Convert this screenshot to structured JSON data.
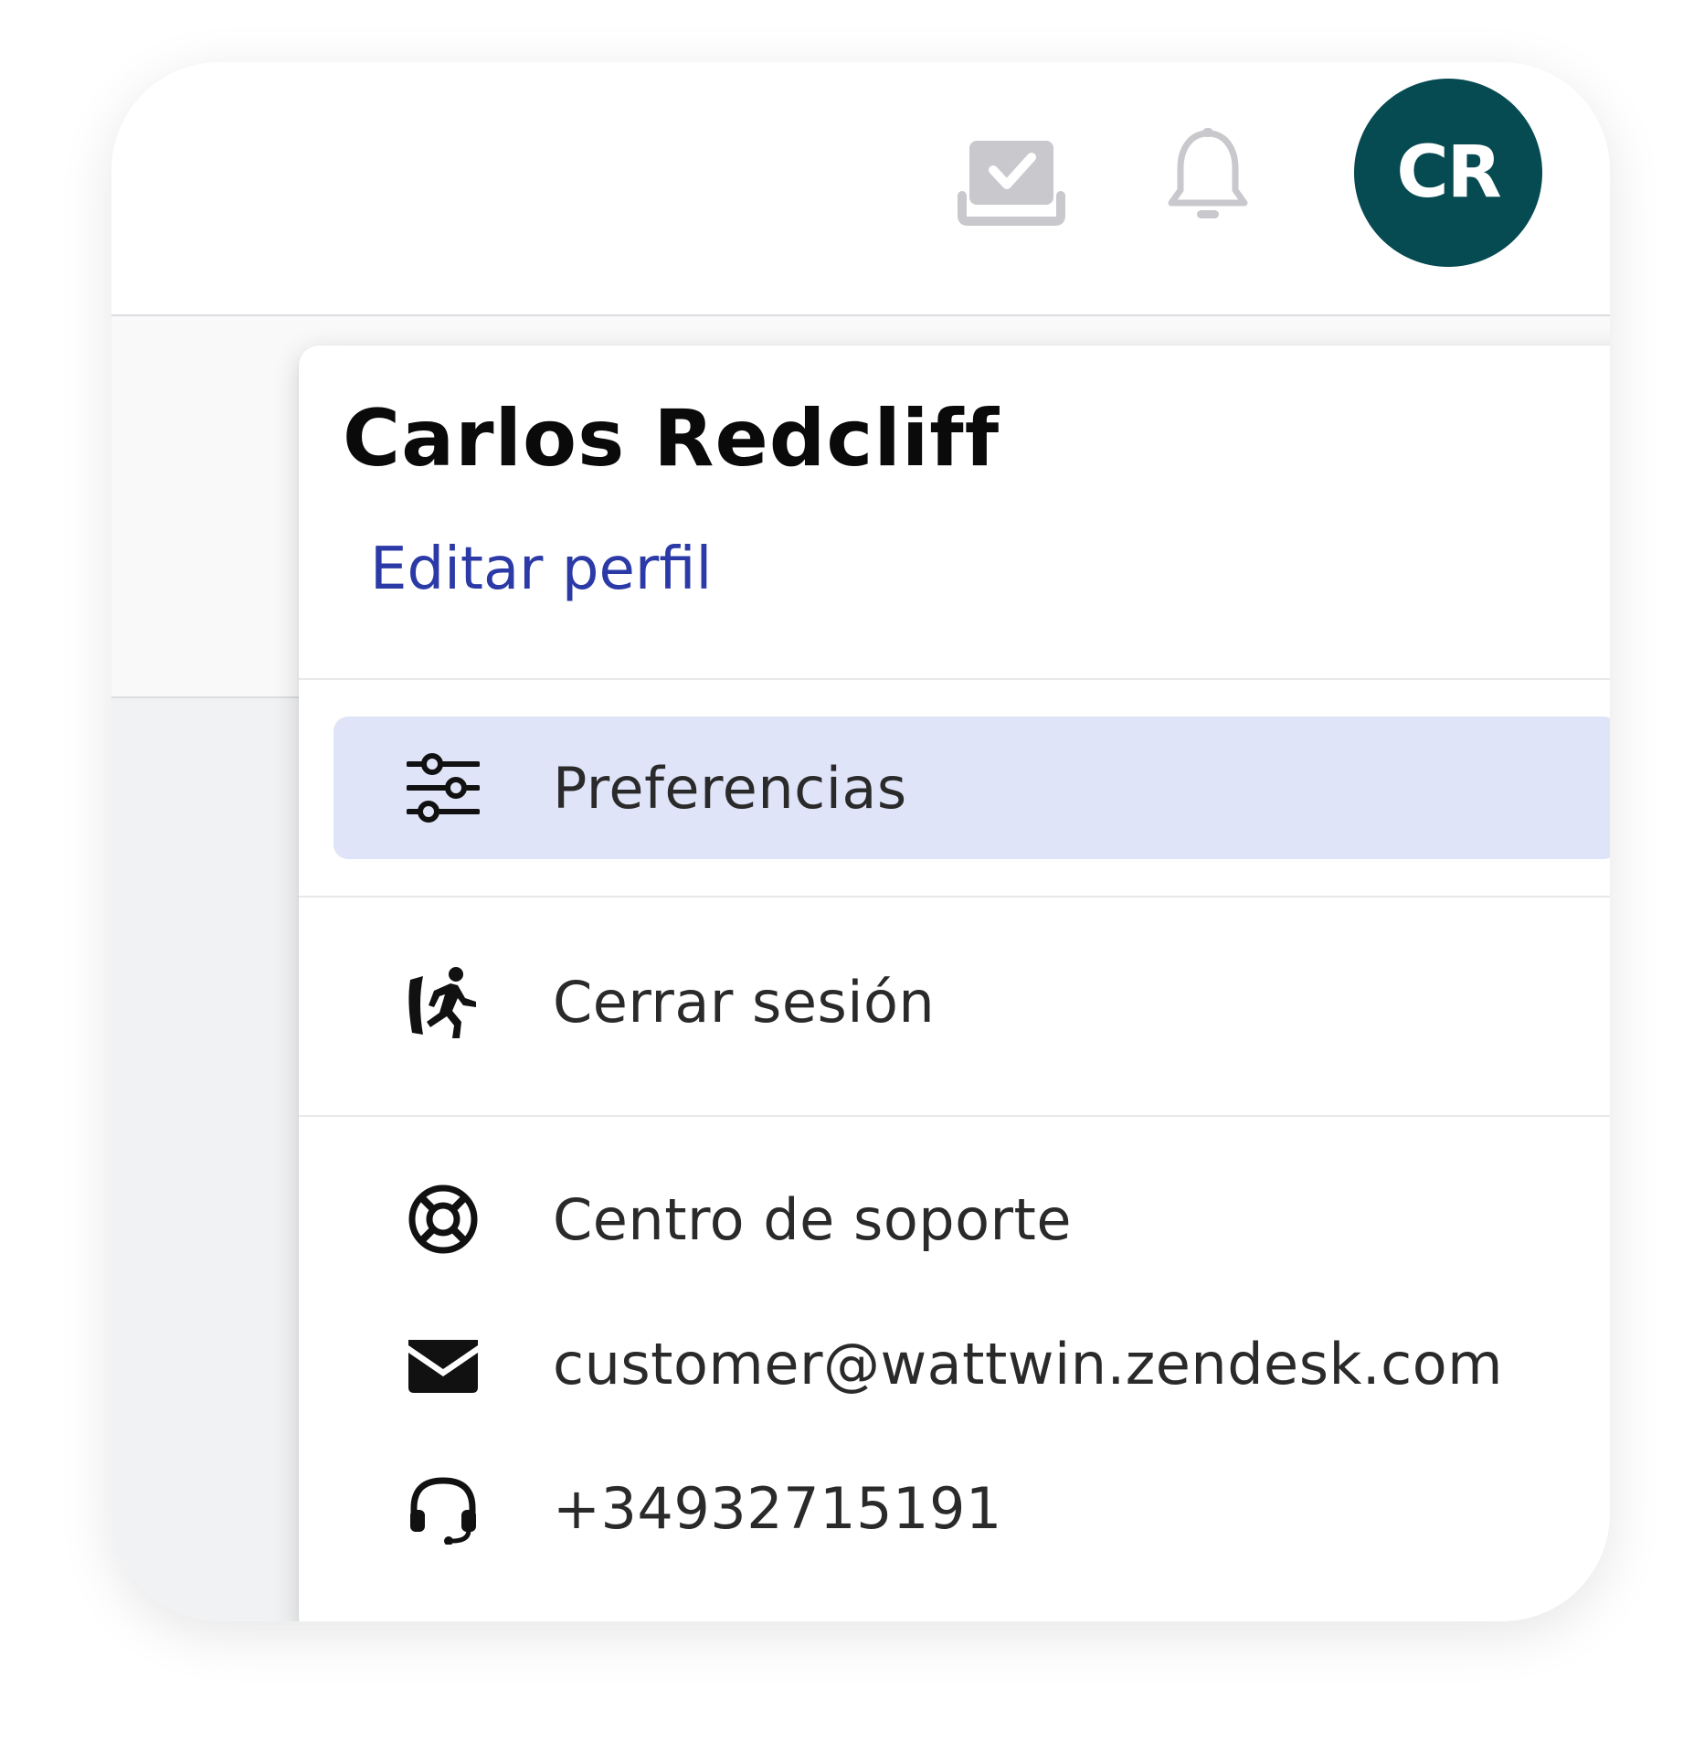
{
  "header": {
    "avatar_initials": "CR",
    "avatar_color": "#064a52",
    "icons": [
      "tasks-inbox-icon",
      "bell-icon"
    ]
  },
  "user_menu": {
    "name": "Carlos Redcliff",
    "edit_profile_label": "Editar perfil",
    "link_color": "#2b3aa6",
    "active_item_bg": "#e0e4f8",
    "items": [
      {
        "label": "Preferencias",
        "icon": "sliders-icon",
        "active": true
      },
      {
        "label": "Cerrar sesión",
        "icon": "running-exit-icon",
        "active": false
      }
    ],
    "support": [
      {
        "label": "Centro de soporte",
        "icon": "lifebuoy-icon"
      },
      {
        "label": "customer@wattwin.zendesk.com",
        "icon": "envelope-icon"
      },
      {
        "label": "+34932715191",
        "icon": "headset-icon"
      }
    ]
  }
}
